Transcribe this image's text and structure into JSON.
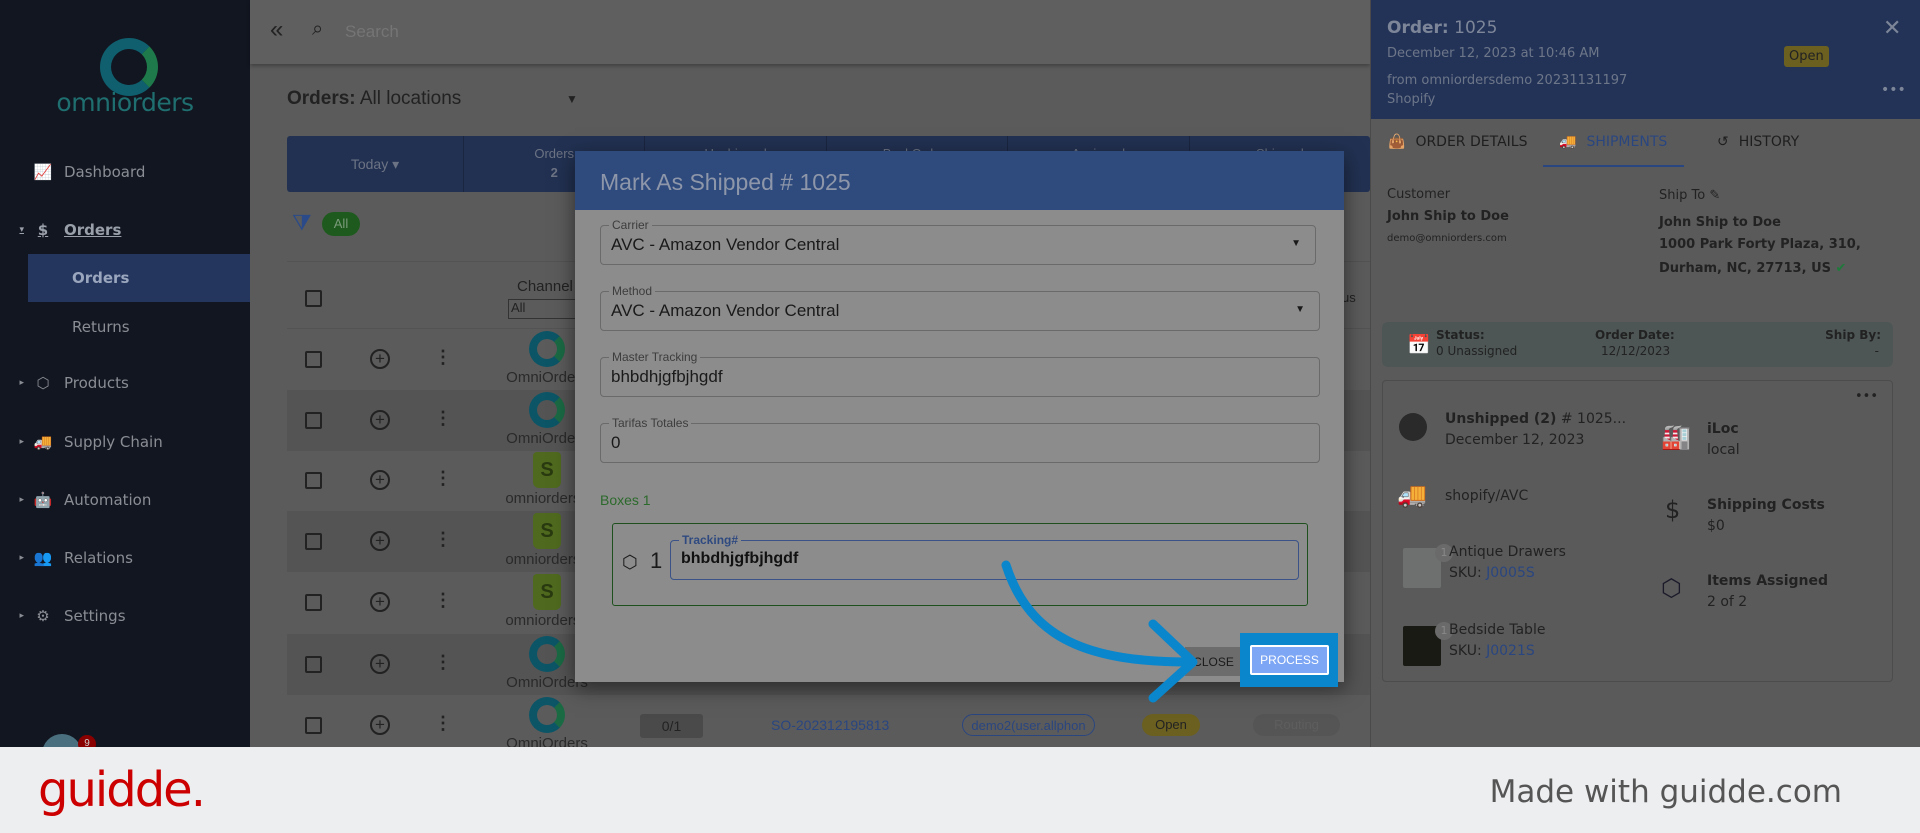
{
  "brand": {
    "logo_text": "omniorders"
  },
  "sidebar": {
    "items": [
      {
        "label": "Dashboard",
        "icon": "chart-line-icon"
      },
      {
        "label": "Orders",
        "icon": "dollar-icon",
        "expanded": true
      },
      {
        "label": "Orders",
        "sub": true,
        "active": true
      },
      {
        "label": "Returns",
        "sub": true
      },
      {
        "label": "Products",
        "icon": "box-icon"
      },
      {
        "label": "Supply Chain",
        "icon": "truck-icon"
      },
      {
        "label": "Automation",
        "icon": "robot-icon"
      },
      {
        "label": "Relations",
        "icon": "users-icon"
      },
      {
        "label": "Settings",
        "icon": "gears-icon"
      }
    ],
    "notification_count": "9"
  },
  "topbar": {
    "search_placeholder": "Search"
  },
  "orders": {
    "label": "Orders:",
    "location": "All locations",
    "stats": {
      "today": "Today",
      "orders_label": "Orders",
      "orders_value": "2",
      "unshipped": "Unshipped",
      "backorders": "BackOrders",
      "assigned": "Assigned",
      "shipped": "Shipped"
    },
    "filter_chip": "All",
    "channel_header": "Channel",
    "channel_filter": "All",
    "status_header_partial": "us",
    "rows": [
      {
        "channel": "omni",
        "label": "OmniOrders"
      },
      {
        "channel": "omni",
        "label": "OmniOrders"
      },
      {
        "channel": "shopify",
        "label": "omniordersd"
      },
      {
        "channel": "shopify",
        "label": "omniordersd"
      },
      {
        "channel": "shopify",
        "label": "omniordersd"
      },
      {
        "channel": "omni",
        "label": "OmniOrders"
      },
      {
        "channel": "omni",
        "label": "OmniOrders",
        "qty": "0/1",
        "order_no": "SO-202312195813",
        "user": "demo2(user.allphon",
        "status": "Open",
        "routing": "Routing"
      }
    ]
  },
  "modal": {
    "title": "Mark As Shipped # 1025",
    "carrier_label": "Carrier",
    "carrier_value": "AVC - Amazon Vendor Central",
    "method_label": "Method",
    "method_value": "AVC - Amazon Vendor Central",
    "master_label": "Master Tracking",
    "master_value": "bhbdhjgfbjhgdf",
    "tarifas_label": "Tarifas Totales",
    "tarifas_value": "0",
    "boxes_label": "Boxes 1",
    "box_number": "1",
    "tracking_label": "Tracking#",
    "tracking_value": "bhbdhjgfbjhgdf",
    "close_label": "CLOSE",
    "process_label": "PROCESS"
  },
  "panel": {
    "order_label": "Order:",
    "order_no": "1025",
    "date": "December 12, 2023 at 10:46 AM",
    "from": "from omniordersdemo 20231131197",
    "source": "Shopify",
    "status_badge": "Open",
    "tabs": [
      {
        "label": "ORDER DETAILS",
        "icon": "bag-icon"
      },
      {
        "label": "SHIPMENTS",
        "icon": "truck-icon",
        "active": true
      },
      {
        "label": "HISTORY",
        "icon": "history-icon"
      }
    ],
    "customer_label": "Customer",
    "customer_name": "John Ship to Doe",
    "customer_email": "demo@omniorders.com",
    "shipto_label": "Ship To",
    "shipto_name": "John Ship to Doe",
    "shipto_line1": "1000 Park Forty Plaza, 310,",
    "shipto_line2": "Durham, NC, 27713, US",
    "status_label": "Status:",
    "status_value": "0 Unassigned",
    "order_date_label": "Order Date:",
    "order_date_value": "12/12/2023",
    "ship_by_label": "Ship By:",
    "ship_by_value": "-",
    "shipment": {
      "title": "Unshipped (2)",
      "ref": "# 1025...",
      "date": "December 12, 2023",
      "carrier": "shopify/AVC",
      "location_label": "iLoc",
      "location_value": "local",
      "costs_label": "Shipping Costs",
      "costs_value": "$0",
      "assigned_label": "Items Assigned",
      "assigned_value": "2 of 2",
      "items": [
        {
          "name": "Antique Drawers",
          "sku_label": "SKU:",
          "sku": "J0005S",
          "qty": "1"
        },
        {
          "name": "Bedside Table",
          "sku_label": "SKU:",
          "sku": "J0021S",
          "qty": "1"
        }
      ]
    }
  },
  "footer": {
    "brand": "guidde.",
    "tagline": "Made with guidde.com"
  },
  "colors": {
    "modal_header": "#2f4a7c",
    "process_button": "#7da6f4",
    "highlight": "#0a86cc",
    "guidde_red": "#cc0000"
  }
}
